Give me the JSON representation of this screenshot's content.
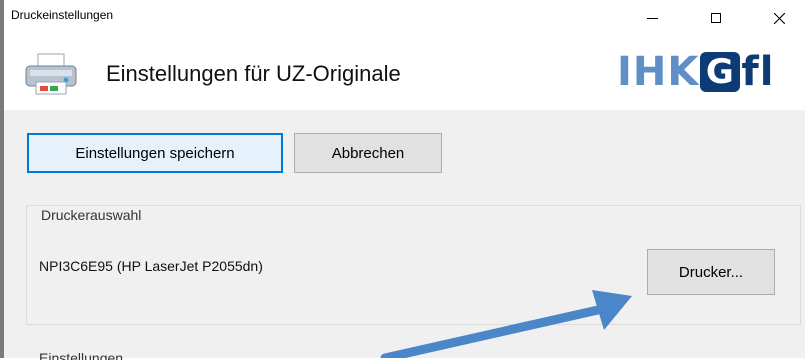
{
  "window": {
    "title": "Druckeinstellungen"
  },
  "header": {
    "title": "Einstellungen für UZ-Originale",
    "logo_text_a": "IHK",
    "logo_text_g": "G",
    "logo_text_b": "fl",
    "icon": "printer-icon"
  },
  "toolbar": {
    "save_label": "Einstellungen speichern",
    "cancel_label": "Abbrechen"
  },
  "printer_selection": {
    "group_label": "Druckerauswahl",
    "selected_printer": "NPI3C6E95 (HP LaserJet P2055dn)",
    "printer_button_label": "Drucker..."
  },
  "settings_section": {
    "label": "Einstellungen"
  },
  "colors": {
    "accent": "#0078d7",
    "logo_light": "#5f8fc6",
    "logo_dark": "#0d3b75",
    "arrow": "#4a86c8"
  }
}
